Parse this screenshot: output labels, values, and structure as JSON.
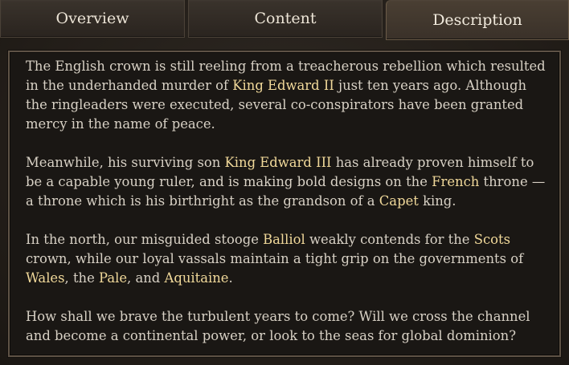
{
  "tabs": [
    {
      "label": "Overview",
      "active": false
    },
    {
      "label": "Content",
      "active": false
    },
    {
      "label": "Description",
      "active": true
    }
  ],
  "colors": {
    "text": "#d8d1c5",
    "highlight": "#f1d99a",
    "background": "#1a1714",
    "border": "#5e5245"
  },
  "description": {
    "paragraphs": [
      {
        "parts": [
          {
            "text": "The English crown is still reeling from a treacherous rebellion which resulted in the underhanded murder of ",
            "hl": false
          },
          {
            "text": "King Edward II",
            "hl": true
          },
          {
            "text": " just ten years ago. Although the ringleaders were executed, several co-conspirators have been granted mercy in the name of peace.",
            "hl": false
          }
        ]
      },
      {
        "parts": [
          {
            "text": "Meanwhile, his surviving son ",
            "hl": false
          },
          {
            "text": "King Edward III",
            "hl": true
          },
          {
            "text": " has already proven himself to be a capable young ruler, and is making bold designs on the ",
            "hl": false
          },
          {
            "text": "French",
            "hl": true
          },
          {
            "text": " throne — a throne which is his birthright as the grandson of a ",
            "hl": false
          },
          {
            "text": "Capet",
            "hl": true
          },
          {
            "text": " king.",
            "hl": false
          }
        ]
      },
      {
        "parts": [
          {
            "text": "In the north, our misguided stooge ",
            "hl": false
          },
          {
            "text": "Balliol",
            "hl": true
          },
          {
            "text": " weakly contends for the ",
            "hl": false
          },
          {
            "text": "Scots",
            "hl": true
          },
          {
            "text": " crown, while our loyal vassals maintain a tight grip on the governments of ",
            "hl": false
          },
          {
            "text": "Wales",
            "hl": true
          },
          {
            "text": ", the ",
            "hl": false
          },
          {
            "text": "Pale",
            "hl": true
          },
          {
            "text": ", and ",
            "hl": false
          },
          {
            "text": "Aquitaine",
            "hl": true
          },
          {
            "text": ".",
            "hl": false
          }
        ]
      },
      {
        "parts": [
          {
            "text": "How shall we brave the turbulent years to come? Will we cross the channel and become a continental power, or look to the seas for global dominion?",
            "hl": false
          }
        ]
      }
    ]
  }
}
